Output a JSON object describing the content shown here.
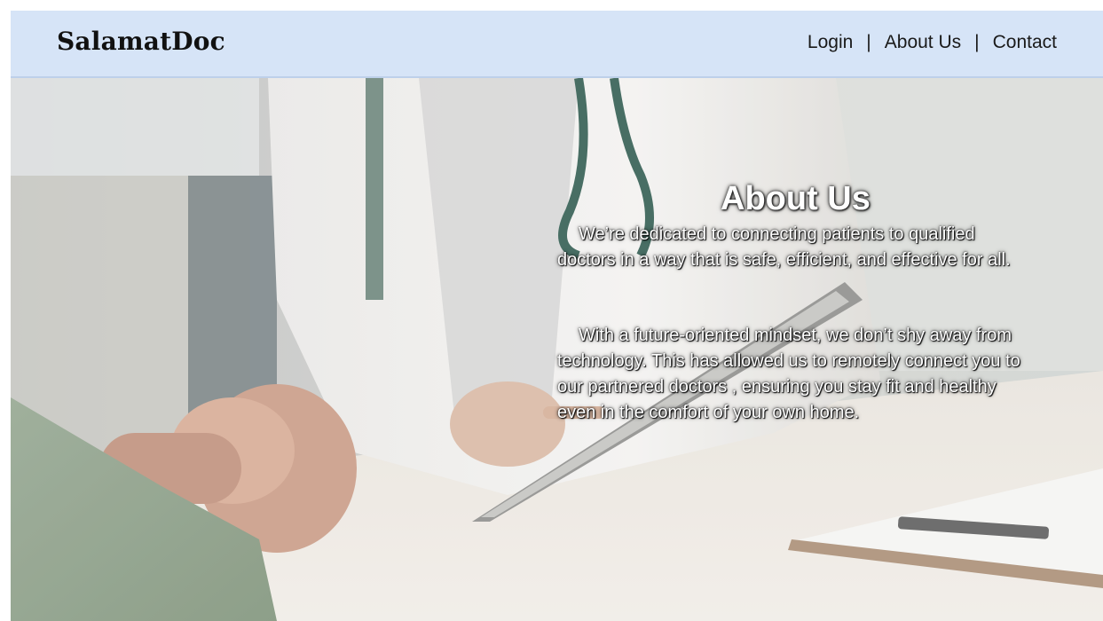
{
  "header": {
    "brand": "SalamatDoc",
    "nav": {
      "login": "Login",
      "about": "About Us",
      "contact": "Contact",
      "separator": "|"
    }
  },
  "hero": {
    "image_alt": "doctor-consultation-photo",
    "title": "About Us",
    "paragraph_1": "We’re dedicated to connecting patients to qualified doctors in a way that is safe, efficient, and effective for all.",
    "paragraph_2": "With a future-oriented mindset, we don’t shy away from technology. This has allowed us to remotely connect you to our partnered doctors , ensuring you stay fit and healthy even in the comfort of your own home."
  },
  "colors": {
    "navbar_bg": "#d6e4f7",
    "text_dark": "#111111",
    "overlay_text": "#ffffff"
  }
}
